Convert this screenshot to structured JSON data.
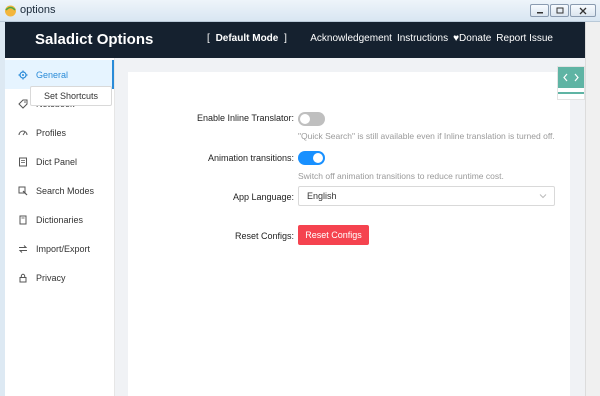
{
  "window": {
    "title": "options"
  },
  "header": {
    "brand": "Saladict Options",
    "mode_open": "[",
    "mode_label": "Default Mode",
    "mode_close": "]",
    "links": {
      "acknowledgement": "Acknowledgement",
      "instructions": "Instructions",
      "donate": "Donate",
      "report_issue": "Report Issue"
    }
  },
  "sidebar": {
    "items": [
      {
        "label": "General",
        "icon": "gear-icon",
        "active": true
      },
      {
        "label": "Notebook",
        "icon": "tag-icon"
      },
      {
        "label": "Profiles",
        "icon": "dashboard-icon"
      },
      {
        "label": "Dict Panel",
        "icon": "layout-icon"
      },
      {
        "label": "Search Modes",
        "icon": "select-icon"
      },
      {
        "label": "Dictionaries",
        "icon": "book-icon"
      },
      {
        "label": "Import/Export",
        "icon": "swap-icon"
      },
      {
        "label": "Privacy",
        "icon": "lock-icon"
      }
    ]
  },
  "general": {
    "set_shortcuts": "Set Shortcuts",
    "inline_translator": {
      "label": "Enable Inline Translator:",
      "enabled": false,
      "hint": "\"Quick Search\" is still available even if Inline translation is turned off."
    },
    "animation": {
      "label": "Animation transitions:",
      "enabled": true,
      "hint": "Switch off animation transitions to reduce runtime cost."
    },
    "language": {
      "label": "App Language:",
      "value": "English"
    },
    "reset": {
      "label": "Reset Configs:",
      "button": "Reset Configs"
    }
  },
  "colors": {
    "header_bg": "#15212f",
    "accent": "#1890ff",
    "danger": "#f5434f",
    "active_nav": "#2a8bd8"
  }
}
